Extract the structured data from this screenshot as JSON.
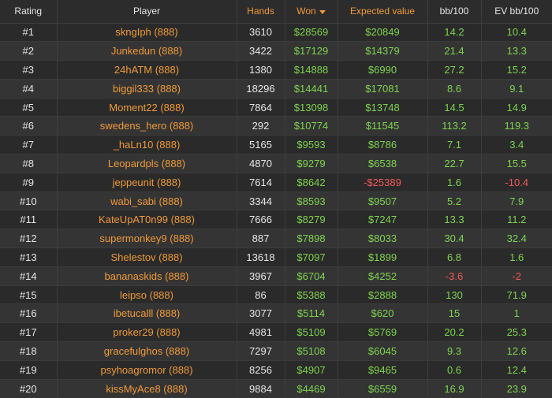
{
  "headers": {
    "rating": "Rating",
    "player": "Player",
    "hands": "Hands",
    "won": "Won",
    "expected": "Expected value",
    "bb100": "bb/100",
    "evbb100": "EV bb/100"
  },
  "colors": {
    "accent": "#ef9a3a",
    "positive": "#7fd34f",
    "negative": "#ee5a5a",
    "text": "#e6e6e6",
    "background": "#2c2c2c"
  },
  "sort": {
    "column": "won",
    "direction": "desc",
    "icon": "caret-down-icon"
  },
  "rows": [
    {
      "rating": "#1",
      "player": "skngIph (888)",
      "hands": "3610",
      "won": "$28569",
      "ev": "$20849",
      "bb100": "14.2",
      "evbb100": "10.4"
    },
    {
      "rating": "#2",
      "player": "Junkedun (888)",
      "hands": "3422",
      "won": "$17129",
      "ev": "$14379",
      "bb100": "21.4",
      "evbb100": "13.3"
    },
    {
      "rating": "#3",
      "player": "24hATM (888)",
      "hands": "1380",
      "won": "$14888",
      "ev": "$6990",
      "bb100": "27.2",
      "evbb100": "15.2"
    },
    {
      "rating": "#4",
      "player": "biggil333 (888)",
      "hands": "18296",
      "won": "$14441",
      "ev": "$17081",
      "bb100": "8.6",
      "evbb100": "9.1"
    },
    {
      "rating": "#5",
      "player": "Moment22 (888)",
      "hands": "7864",
      "won": "$13098",
      "ev": "$13748",
      "bb100": "14.5",
      "evbb100": "14.9"
    },
    {
      "rating": "#6",
      "player": "swedens_hero (888)",
      "hands": "292",
      "won": "$10774",
      "ev": "$11545",
      "bb100": "113.2",
      "evbb100": "119.3"
    },
    {
      "rating": "#7",
      "player": "_haLn10 (888)",
      "hands": "5165",
      "won": "$9593",
      "ev": "$8786",
      "bb100": "7.1",
      "evbb100": "3.4"
    },
    {
      "rating": "#8",
      "player": "Leopardpls (888)",
      "hands": "4870",
      "won": "$9279",
      "ev": "$6538",
      "bb100": "22.7",
      "evbb100": "15.5"
    },
    {
      "rating": "#9",
      "player": "jeppeunit (888)",
      "hands": "7614",
      "won": "$8642",
      "ev": "-$25389",
      "bb100": "1.6",
      "evbb100": "-10.4"
    },
    {
      "rating": "#10",
      "player": "wabi_sabi (888)",
      "hands": "3344",
      "won": "$8593",
      "ev": "$9507",
      "bb100": "5.2",
      "evbb100": "7.9"
    },
    {
      "rating": "#11",
      "player": "KateUpAT0n99 (888)",
      "hands": "7666",
      "won": "$8279",
      "ev": "$7247",
      "bb100": "13.3",
      "evbb100": "11.2"
    },
    {
      "rating": "#12",
      "player": "supermonkey9 (888)",
      "hands": "887",
      "won": "$7898",
      "ev": "$8033",
      "bb100": "30.4",
      "evbb100": "32.4"
    },
    {
      "rating": "#13",
      "player": "Shelestov (888)",
      "hands": "13618",
      "won": "$7097",
      "ev": "$1899",
      "bb100": "6.8",
      "evbb100": "1.6"
    },
    {
      "rating": "#14",
      "player": "bananaskids (888)",
      "hands": "3967",
      "won": "$6704",
      "ev": "$4252",
      "bb100": "-3.6",
      "evbb100": "-2"
    },
    {
      "rating": "#15",
      "player": "leipso (888)",
      "hands": "86",
      "won": "$5388",
      "ev": "$2888",
      "bb100": "130",
      "evbb100": "71.9"
    },
    {
      "rating": "#16",
      "player": "ibetucalll (888)",
      "hands": "3077",
      "won": "$5114",
      "ev": "$620",
      "bb100": "15",
      "evbb100": "1"
    },
    {
      "rating": "#17",
      "player": "proker29 (888)",
      "hands": "4981",
      "won": "$5109",
      "ev": "$5769",
      "bb100": "20.2",
      "evbb100": "25.3"
    },
    {
      "rating": "#18",
      "player": "gracefulghos (888)",
      "hands": "7297",
      "won": "$5108",
      "ev": "$6045",
      "bb100": "9.3",
      "evbb100": "12.6"
    },
    {
      "rating": "#19",
      "player": "psyhoagromor (888)",
      "hands": "8256",
      "won": "$4907",
      "ev": "$9465",
      "bb100": "0.6",
      "evbb100": "12.4"
    },
    {
      "rating": "#20",
      "player": "kissMyAce8 (888)",
      "hands": "9884",
      "won": "$4469",
      "ev": "$6559",
      "bb100": "16.9",
      "evbb100": "23.9"
    }
  ]
}
